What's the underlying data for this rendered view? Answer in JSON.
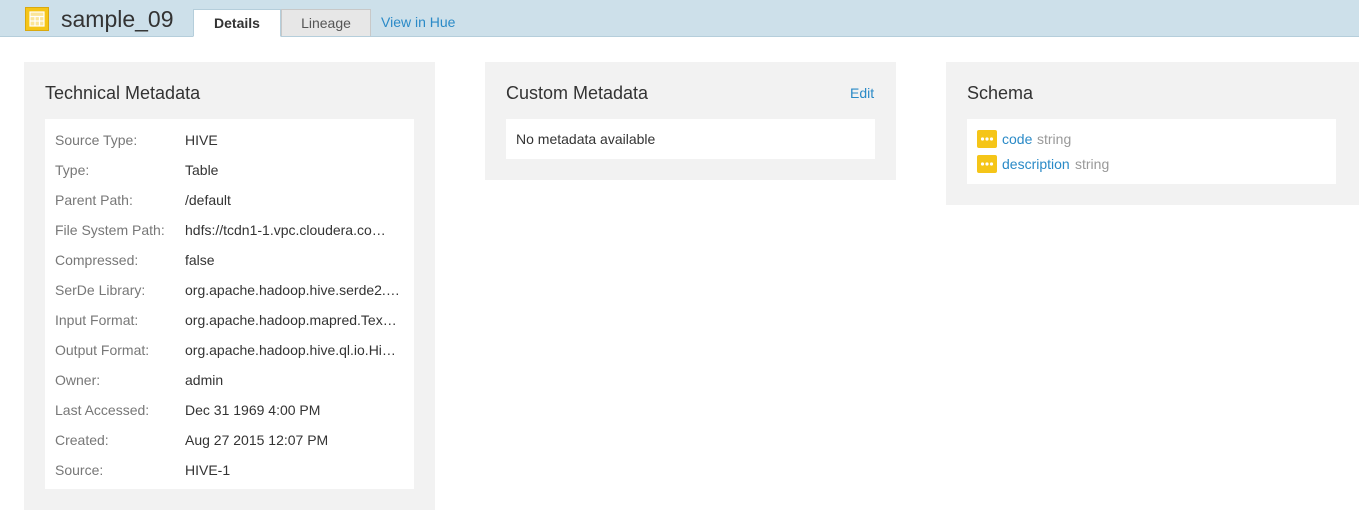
{
  "header": {
    "title": "sample_09",
    "icon": "table-icon",
    "accent_color": "#f5c518",
    "tabs": [
      {
        "label": "Details",
        "active": true
      },
      {
        "label": "Lineage",
        "active": false
      }
    ],
    "hue_link": "View in Hue"
  },
  "technical": {
    "title": "Technical Metadata",
    "rows": [
      {
        "label": "Source Type:",
        "value": "HIVE"
      },
      {
        "label": "Type:",
        "value": "Table"
      },
      {
        "label": "Parent Path:",
        "value": "/default"
      },
      {
        "label": "File System Path:",
        "value": "hdfs://tcdn1-1.vpc.cloudera.co…"
      },
      {
        "label": "Compressed:",
        "value": "false"
      },
      {
        "label": "SerDe Library:",
        "value": "org.apache.hadoop.hive.serde2.…"
      },
      {
        "label": "Input Format:",
        "value": "org.apache.hadoop.mapred.Tex…"
      },
      {
        "label": "Output Format:",
        "value": "org.apache.hadoop.hive.ql.io.Hi…"
      },
      {
        "label": "Owner:",
        "value": "admin"
      },
      {
        "label": "Last Accessed:",
        "value": "Dec 31 1969 4:00 PM"
      },
      {
        "label": "Created:",
        "value": "Aug 27 2015 12:07 PM"
      },
      {
        "label": "Source:",
        "value": "HIVE-1"
      }
    ]
  },
  "custom": {
    "title": "Custom Metadata",
    "edit_label": "Edit",
    "empty_text": "No metadata available"
  },
  "schema": {
    "title": "Schema",
    "columns": [
      {
        "name": "code",
        "type": "string",
        "icon": "column-icon"
      },
      {
        "name": "description",
        "type": "string",
        "icon": "column-icon"
      }
    ]
  }
}
